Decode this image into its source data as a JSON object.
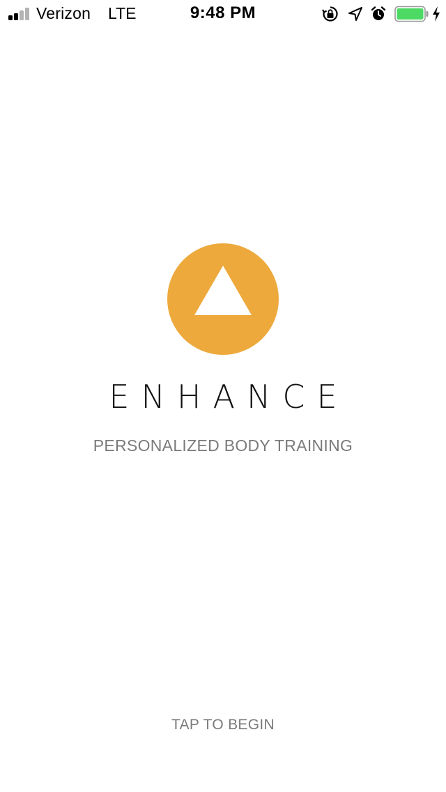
{
  "status_bar": {
    "carrier": "Verizon",
    "network": "LTE",
    "time": "9:48 PM",
    "signal_bars": 4,
    "signal_bars_filled": 2,
    "battery_level": 1.0,
    "battery_color": "#4cd964",
    "icons": [
      "orientation-lock-icon",
      "location-arrow-icon",
      "alarm-icon",
      "battery-icon",
      "charging-bolt-icon"
    ]
  },
  "splash": {
    "logo_color": "#eda93c",
    "logo_icon": "triangle-icon",
    "app_name": "ENHANCE",
    "tagline": "PERSONALIZED BODY TRAINING",
    "cta": "TAP TO BEGIN"
  }
}
